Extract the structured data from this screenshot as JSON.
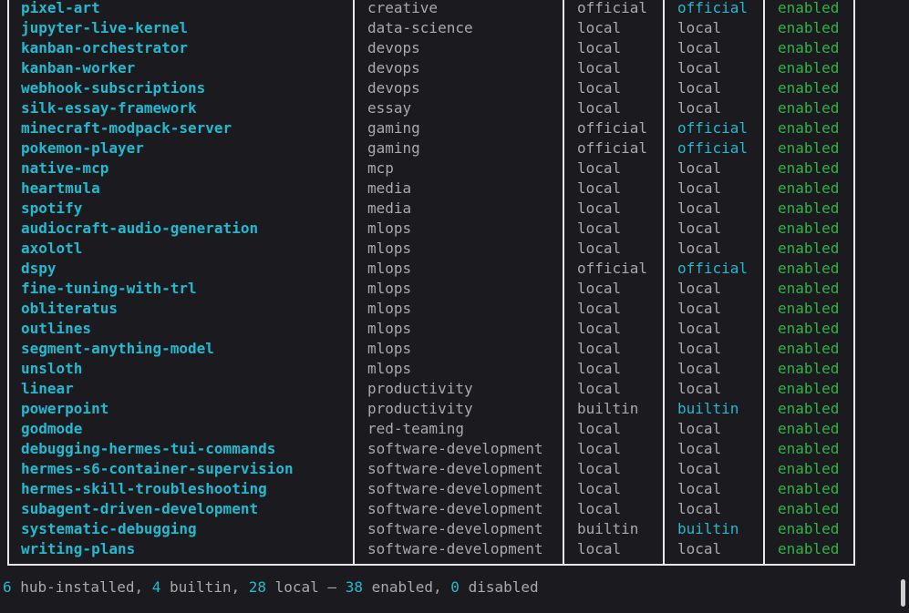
{
  "colors": {
    "background": "#1b1b1f",
    "name": "#22b8cf",
    "muted": "#a9a9a9",
    "enabled": "#2fb344",
    "border": "#e8e8e8"
  },
  "rows": [
    {
      "name": "pixel-art",
      "category": "creative",
      "source": "official",
      "trust": "official",
      "status": "enabled"
    },
    {
      "name": "jupyter-live-kernel",
      "category": "data-science",
      "source": "local",
      "trust": "local",
      "status": "enabled"
    },
    {
      "name": "kanban-orchestrator",
      "category": "devops",
      "source": "local",
      "trust": "local",
      "status": "enabled"
    },
    {
      "name": "kanban-worker",
      "category": "devops",
      "source": "local",
      "trust": "local",
      "status": "enabled"
    },
    {
      "name": "webhook-subscriptions",
      "category": "devops",
      "source": "local",
      "trust": "local",
      "status": "enabled"
    },
    {
      "name": "silk-essay-framework",
      "category": "essay",
      "source": "local",
      "trust": "local",
      "status": "enabled"
    },
    {
      "name": "minecraft-modpack-server",
      "category": "gaming",
      "source": "official",
      "trust": "official",
      "status": "enabled"
    },
    {
      "name": "pokemon-player",
      "category": "gaming",
      "source": "official",
      "trust": "official",
      "status": "enabled"
    },
    {
      "name": "native-mcp",
      "category": "mcp",
      "source": "local",
      "trust": "local",
      "status": "enabled"
    },
    {
      "name": "heartmula",
      "category": "media",
      "source": "local",
      "trust": "local",
      "status": "enabled"
    },
    {
      "name": "spotify",
      "category": "media",
      "source": "local",
      "trust": "local",
      "status": "enabled"
    },
    {
      "name": "audiocraft-audio-generation",
      "category": "mlops",
      "source": "local",
      "trust": "local",
      "status": "enabled"
    },
    {
      "name": "axolotl",
      "category": "mlops",
      "source": "local",
      "trust": "local",
      "status": "enabled"
    },
    {
      "name": "dspy",
      "category": "mlops",
      "source": "official",
      "trust": "official",
      "status": "enabled"
    },
    {
      "name": "fine-tuning-with-trl",
      "category": "mlops",
      "source": "local",
      "trust": "local",
      "status": "enabled"
    },
    {
      "name": "obliteratus",
      "category": "mlops",
      "source": "local",
      "trust": "local",
      "status": "enabled"
    },
    {
      "name": "outlines",
      "category": "mlops",
      "source": "local",
      "trust": "local",
      "status": "enabled"
    },
    {
      "name": "segment-anything-model",
      "category": "mlops",
      "source": "local",
      "trust": "local",
      "status": "enabled"
    },
    {
      "name": "unsloth",
      "category": "mlops",
      "source": "local",
      "trust": "local",
      "status": "enabled"
    },
    {
      "name": "linear",
      "category": "productivity",
      "source": "local",
      "trust": "local",
      "status": "enabled"
    },
    {
      "name": "powerpoint",
      "category": "productivity",
      "source": "builtin",
      "trust": "builtin",
      "status": "enabled"
    },
    {
      "name": "godmode",
      "category": "red-teaming",
      "source": "local",
      "trust": "local",
      "status": "enabled"
    },
    {
      "name": "debugging-hermes-tui-commands",
      "category": "software-development",
      "source": "local",
      "trust": "local",
      "status": "enabled"
    },
    {
      "name": "hermes-s6-container-supervision",
      "category": "software-development",
      "source": "local",
      "trust": "local",
      "status": "enabled"
    },
    {
      "name": "hermes-skill-troubleshooting",
      "category": "software-development",
      "source": "local",
      "trust": "local",
      "status": "enabled"
    },
    {
      "name": "subagent-driven-development",
      "category": "software-development",
      "source": "local",
      "trust": "local",
      "status": "enabled"
    },
    {
      "name": "systematic-debugging",
      "category": "software-development",
      "source": "builtin",
      "trust": "builtin",
      "status": "enabled"
    },
    {
      "name": "writing-plans",
      "category": "software-development",
      "source": "local",
      "trust": "local",
      "status": "enabled"
    }
  ],
  "summary": {
    "hub_count": "6",
    "hub_label": " hub-installed, ",
    "builtin_count": "4",
    "builtin_label": " builtin, ",
    "local_count": "28",
    "local_label": " local — ",
    "enabled_count": "38",
    "enabled_label": " enabled, ",
    "disabled_count": "0",
    "disabled_label": " disabled"
  }
}
